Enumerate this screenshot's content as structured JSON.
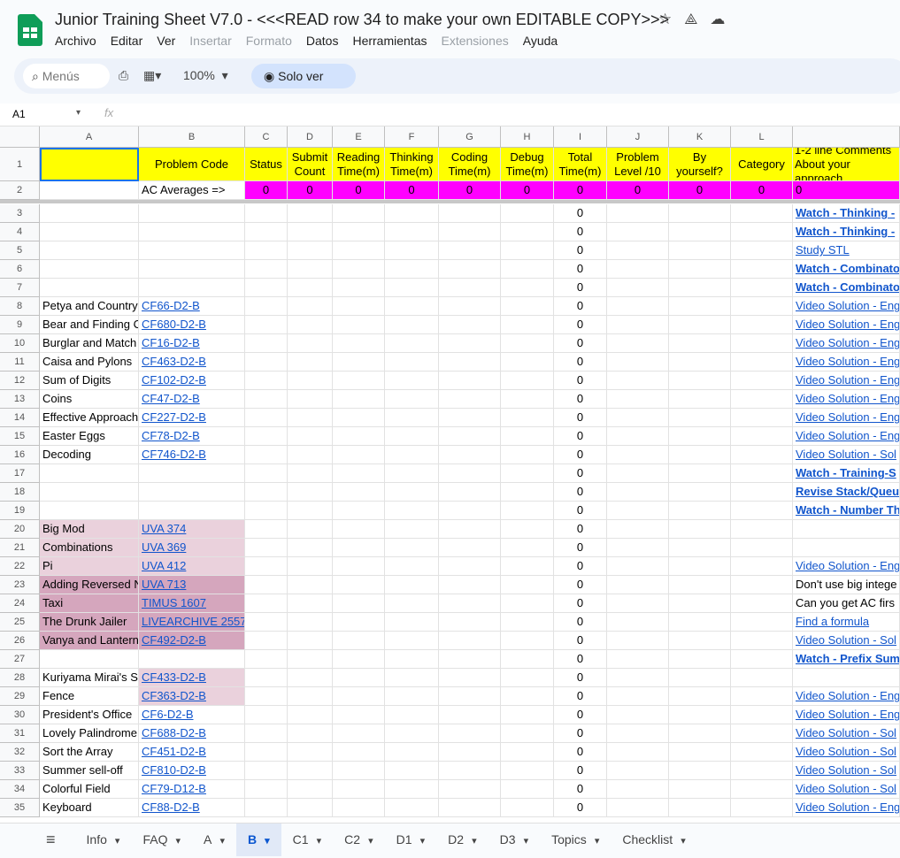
{
  "app": {
    "title": "Junior Training Sheet V7.0 - <<<READ row 34 to make your own EDITABLE COPY>>>",
    "menu": [
      {
        "label": "Archivo",
        "enabled": true
      },
      {
        "label": "Editar",
        "enabled": true
      },
      {
        "label": "Ver",
        "enabled": true
      },
      {
        "label": "Insertar",
        "enabled": false
      },
      {
        "label": "Formato",
        "enabled": false
      },
      {
        "label": "Datos",
        "enabled": true
      },
      {
        "label": "Herramientas",
        "enabled": true
      },
      {
        "label": "Extensiones",
        "enabled": false
      },
      {
        "label": "Ayuda",
        "enabled": true
      }
    ]
  },
  "toolbar": {
    "search_placeholder": "Menús",
    "zoom": "100%",
    "mode": "Solo ver"
  },
  "formula": {
    "cell": "A1",
    "fx": "fx"
  },
  "columns": [
    "A",
    "B",
    "C",
    "D",
    "E",
    "F",
    "G",
    "H",
    "I",
    "J",
    "K",
    "L",
    ""
  ],
  "header_row": [
    "",
    "Problem Code",
    "Status",
    "Submit Count",
    "Reading Time(m)",
    "Thinking Time(m)",
    "Coding Time(m)",
    "Debug Time(m)",
    "Total Time(m)",
    "Problem Level /10",
    "By yourself?",
    "Category",
    "1-2 line Comments About your approach"
  ],
  "averages_row": {
    "label": "AC Averages =>",
    "values": [
      "0",
      "0",
      "0",
      "0",
      "0",
      "0",
      "0",
      "0",
      "0",
      "0",
      "0"
    ]
  },
  "colors": {
    "header": "#ffff00",
    "averages": "#ff00ff",
    "pink_light": "#ead1dc",
    "pink_dark": "#d5a6bd",
    "link": "#1155cc"
  },
  "rows": [
    {
      "n": 3,
      "a": "",
      "b": "",
      "i": "0",
      "m": "Watch - Thinking -",
      "mt": "bold"
    },
    {
      "n": 4,
      "a": "",
      "b": "",
      "i": "0",
      "m": "Watch - Thinking -",
      "mt": "bold"
    },
    {
      "n": 5,
      "a": "",
      "b": "",
      "i": "0",
      "m": "Study STL",
      "mt": "link"
    },
    {
      "n": 6,
      "a": "",
      "b": "",
      "i": "0",
      "m": "Watch - Combinato",
      "mt": "bold"
    },
    {
      "n": 7,
      "a": "",
      "b": "",
      "i": "0",
      "m": "Watch - Combinato",
      "mt": "bold"
    },
    {
      "n": 8,
      "a": "Petya and Country",
      "b": "CF66-D2-B",
      "i": "0",
      "m": "Video Solution - Eng",
      "mt": "link"
    },
    {
      "n": 9,
      "a": "Bear and Finding C",
      "b": "CF680-D2-B",
      "i": "0",
      "m": "Video Solution - Eng",
      "mt": "link"
    },
    {
      "n": 10,
      "a": "Burglar and Match",
      "b": "CF16-D2-B",
      "i": "0",
      "m": "Video Solution - Eng",
      "mt": "link"
    },
    {
      "n": 11,
      "a": "Caisa and Pylons",
      "b": "CF463-D2-B",
      "i": "0",
      "m": "Video Solution - Eng",
      "mt": "link"
    },
    {
      "n": 12,
      "a": "Sum of Digits",
      "b": "CF102-D2-B",
      "i": "0",
      "m": "Video Solution - Eng",
      "mt": "link"
    },
    {
      "n": 13,
      "a": "Coins",
      "b": "CF47-D2-B",
      "i": "0",
      "m": "Video Solution - Eng",
      "mt": "link"
    },
    {
      "n": 14,
      "a": "Effective Approach",
      "b": "CF227-D2-B",
      "i": "0",
      "m": "Video Solution - Eng",
      "mt": "link"
    },
    {
      "n": 15,
      "a": "Easter Eggs",
      "b": "CF78-D2-B",
      "i": "0",
      "m": "Video Solution - Eng",
      "mt": "link"
    },
    {
      "n": 16,
      "a": "Decoding",
      "b": "CF746-D2-B",
      "i": "0",
      "m": "Video Solution - Sol",
      "mt": "link"
    },
    {
      "n": 17,
      "a": "",
      "b": "",
      "i": "0",
      "m": "Watch - Training-S",
      "mt": "bold"
    },
    {
      "n": 18,
      "a": "",
      "b": "",
      "i": "0",
      "m": "Revise Stack/Queu",
      "mt": "bold"
    },
    {
      "n": 19,
      "a": "",
      "b": "",
      "i": "0",
      "m": "Watch - Number Th",
      "mt": "bold"
    },
    {
      "n": 20,
      "a": "Big Mod",
      "b": "UVA 374",
      "i": "0",
      "m": "",
      "mt": "",
      "bg": "light"
    },
    {
      "n": 21,
      "a": "Combinations",
      "b": "UVA 369",
      "i": "0",
      "m": "",
      "mt": "",
      "bg": "light"
    },
    {
      "n": 22,
      "a": "Pi",
      "b": "UVA 412",
      "i": "0",
      "m": "Video Solution - Eng",
      "mt": "link",
      "bg": "light"
    },
    {
      "n": 23,
      "a": "Adding Reversed N",
      "b": "UVA 713",
      "i": "0",
      "m": "Don't use big intege",
      "mt": "text",
      "bg": "dark"
    },
    {
      "n": 24,
      "a": "Taxi",
      "b": "TIMUS 1607",
      "i": "0",
      "m": "Can you get AC firs",
      "mt": "text",
      "bg": "dark"
    },
    {
      "n": 25,
      "a": "The Drunk Jailer",
      "b": "LIVEARCHIVE 2557",
      "i": "0",
      "m": "Find a formula",
      "mt": "link",
      "bg": "dark"
    },
    {
      "n": 26,
      "a": "Vanya and Lantern",
      "b": "CF492-D2-B",
      "i": "0",
      "m": "Video Solution - Sol",
      "mt": "link",
      "bg": "dark"
    },
    {
      "n": 27,
      "a": "",
      "b": "",
      "i": "0",
      "m": "Watch - Prefix Sum",
      "mt": "bold"
    },
    {
      "n": 28,
      "a": "Kuriyama Mirai's S",
      "b": "CF433-D2-B",
      "i": "0",
      "m": "",
      "mt": "",
      "bg": "lightb"
    },
    {
      "n": 29,
      "a": "Fence",
      "b": "CF363-D2-B",
      "i": "0",
      "m": "Video Solution - Eng",
      "mt": "link",
      "bg": "lightb"
    },
    {
      "n": 30,
      "a": "President's Office",
      "b": "CF6-D2-B",
      "i": "0",
      "m": "Video Solution - Eng",
      "mt": "link"
    },
    {
      "n": 31,
      "a": "Lovely Palindrome",
      "b": "CF688-D2-B",
      "i": "0",
      "m": "Video Solution - Sol",
      "mt": "link"
    },
    {
      "n": 32,
      "a": "Sort the Array",
      "b": "CF451-D2-B",
      "i": "0",
      "m": "Video Solution - Sol",
      "mt": "link"
    },
    {
      "n": 33,
      "a": "Summer sell-off",
      "b": "CF810-D2-B",
      "i": "0",
      "m": "Video Solution - Sol",
      "mt": "link"
    },
    {
      "n": 34,
      "a": "Colorful Field",
      "b": "CF79-D12-B",
      "i": "0",
      "m": "Video Solution - Sol",
      "mt": "link"
    },
    {
      "n": 35,
      "a": "Keyboard",
      "b": "CF88-D2-B",
      "i": "0",
      "m": "Video Solution - Eng",
      "mt": "link"
    }
  ],
  "sheets": [
    {
      "label": "Info"
    },
    {
      "label": "FAQ"
    },
    {
      "label": "A"
    },
    {
      "label": "B",
      "active": true
    },
    {
      "label": "C1"
    },
    {
      "label": "C2"
    },
    {
      "label": "D1"
    },
    {
      "label": "D2"
    },
    {
      "label": "D3"
    },
    {
      "label": "Topics"
    },
    {
      "label": "Checklist"
    }
  ]
}
